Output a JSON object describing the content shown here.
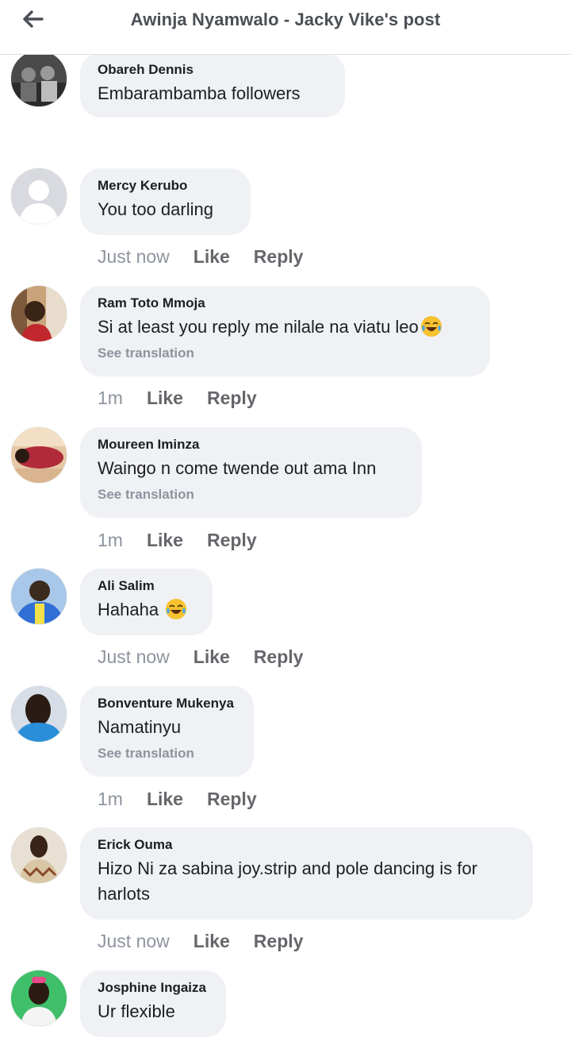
{
  "header": {
    "title": "Awinja Nyamwalo - Jacky Vike's post",
    "back_icon": "arrow-left-icon"
  },
  "actions": {
    "like": "Like",
    "reply": "Reply",
    "see_translation": "See translation"
  },
  "comments": [
    {
      "author": "Obareh Dennis",
      "text": "Embarambamba followers"
    },
    {
      "author": "Mercy Kerubo",
      "text": "You too darling",
      "time": "Just now"
    },
    {
      "author": "Ram Toto Mmoja",
      "text": "Si at least you reply me nilale na viatu leo",
      "emoji": "face-with-tears-of-joy",
      "time": "1m"
    },
    {
      "author": "Moureen Iminza",
      "text": "Waingo n come twende out ama Inn",
      "time": "1m"
    },
    {
      "author": "Ali Salim",
      "text": "Hahaha",
      "emoji": "face-with-tears-of-joy",
      "time": "Just now"
    },
    {
      "author": "Bonventure Mukenya",
      "text": "Namatinyu",
      "time": "1m"
    },
    {
      "author": "Erick Ouma",
      "text_line1": "Hizo Ni za sabina joy.strip and pole dancing is for",
      "text_line2": "harlots",
      "time": "Just now"
    },
    {
      "author": "Josphine Ingaiza",
      "text": "Ur flexible"
    }
  ]
}
